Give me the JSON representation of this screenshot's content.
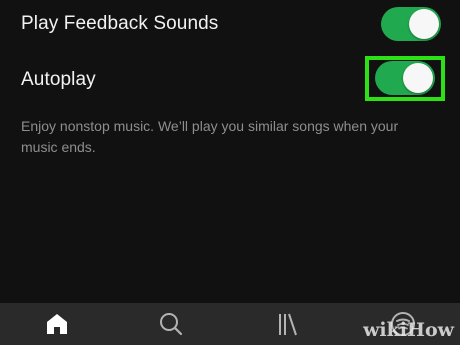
{
  "settings": [
    {
      "label": "Play Feedback Sounds",
      "enabled": true
    },
    {
      "label": "Autoplay",
      "enabled": true,
      "highlighted": true,
      "description": "Enjoy nonstop music. We’ll play you similar songs when your music ends."
    }
  ],
  "tabbar": {
    "tabs": [
      {
        "icon": "home-icon",
        "active": true
      },
      {
        "icon": "search-icon",
        "active": false
      },
      {
        "icon": "library-icon",
        "active": false
      },
      {
        "icon": "spotify-icon",
        "active": false
      }
    ]
  },
  "watermark": "wikiHow",
  "colors": {
    "background": "#111111",
    "toggle_on": "#20a94f",
    "highlight": "#2ee016",
    "tabbar": "#2a2a2a"
  }
}
